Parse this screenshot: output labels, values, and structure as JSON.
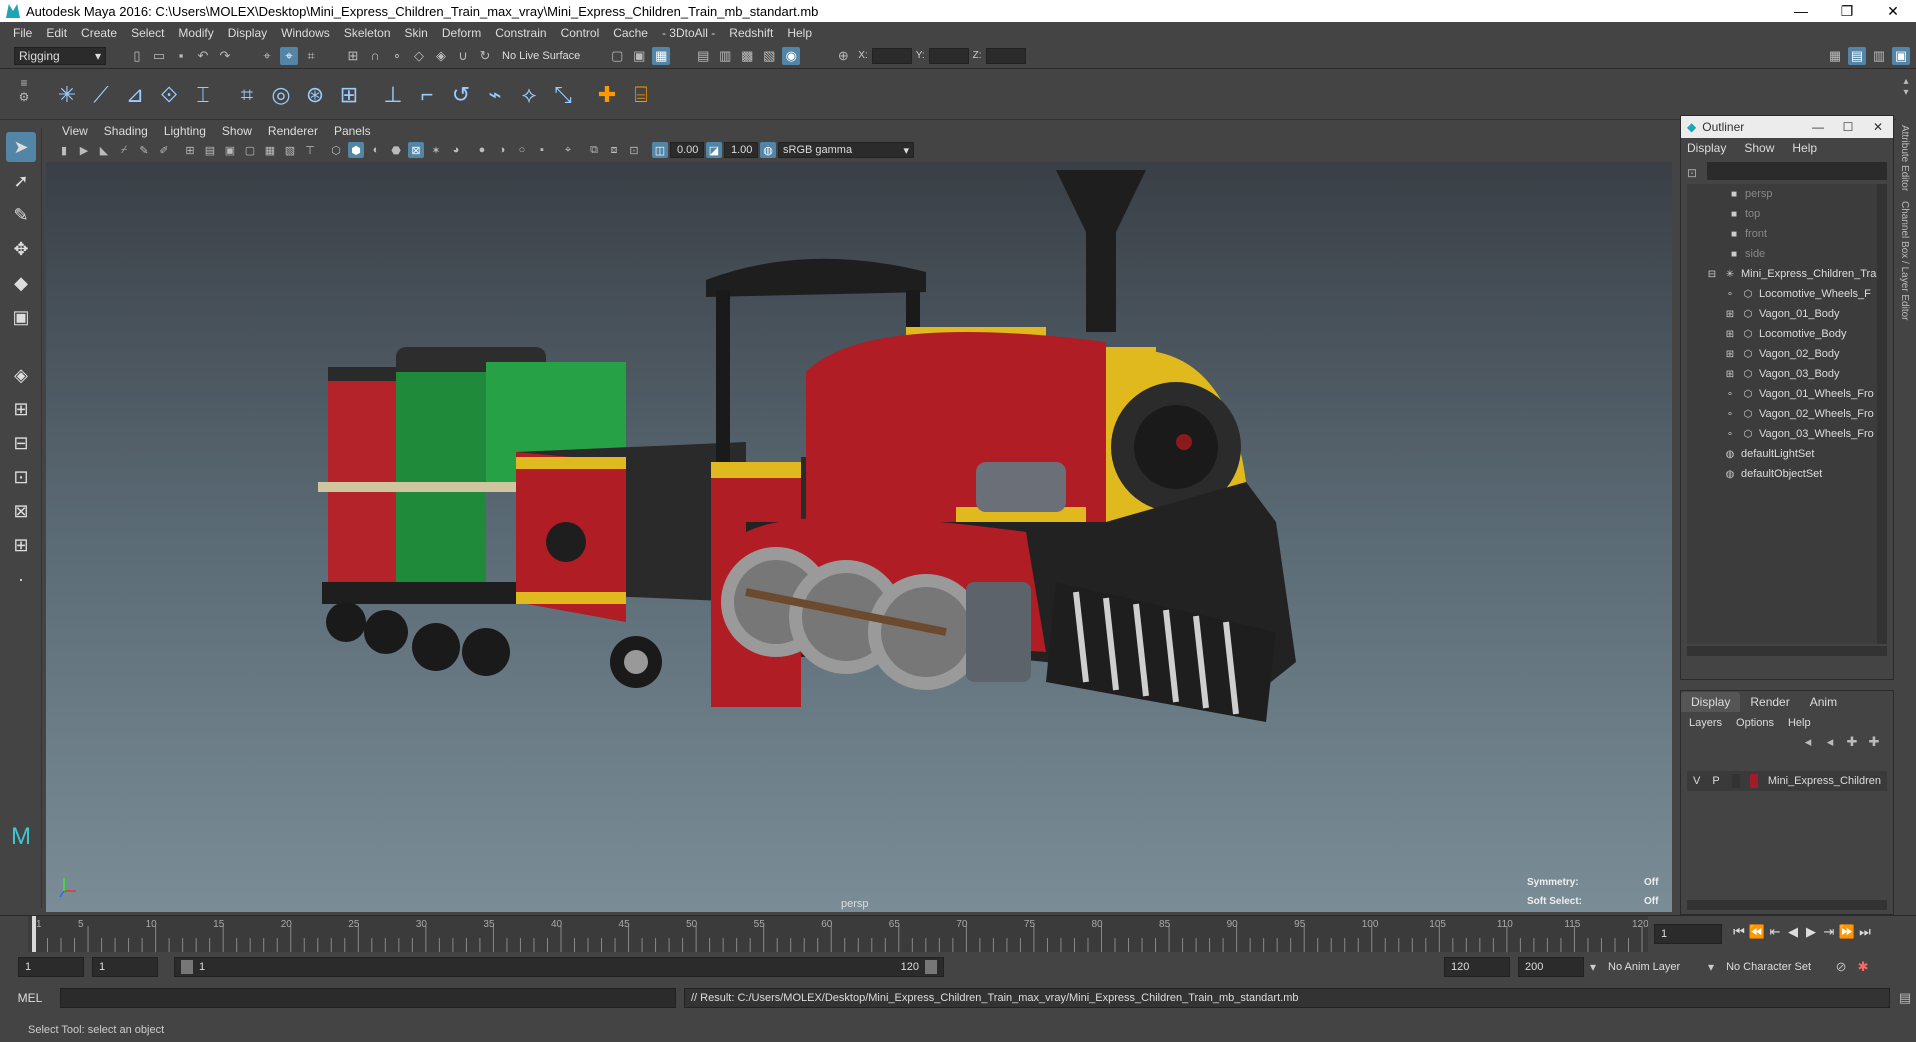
{
  "window": {
    "title": "Autodesk Maya 2016: C:\\Users\\MOLEX\\Desktop\\Mini_Express_Children_Train_max_vray\\Mini_Express_Children_Train_mb_standart.mb"
  },
  "menubar": [
    "File",
    "Edit",
    "Create",
    "Select",
    "Modify",
    "Display",
    "Windows",
    "Skeleton",
    "Skin",
    "Deform",
    "Constrain",
    "Control",
    "Cache",
    "- 3DtoAll -",
    "Redshift",
    "Help"
  ],
  "statusline": {
    "mode": "Rigging",
    "live_surface": "No Live Surface",
    "x_label": "X:",
    "y_label": "Y:",
    "z_label": "Z:"
  },
  "viewport": {
    "menu": [
      "View",
      "Shading",
      "Lighting",
      "Show",
      "Renderer",
      "Panels"
    ],
    "exposure": "0.00",
    "gamma": "1.00",
    "colorspace": "sRGB gamma",
    "camera_label": "persp",
    "symmetry_label": "Symmetry:",
    "symmetry_value": "Off",
    "soft_select_label": "Soft Select:",
    "soft_select_value": "Off"
  },
  "outliner": {
    "title": "Outliner",
    "menu": [
      "Display",
      "Show",
      "Help"
    ],
    "items": [
      {
        "label": "persp",
        "dim": true
      },
      {
        "label": "top",
        "dim": true
      },
      {
        "label": "front",
        "dim": true
      },
      {
        "label": "side",
        "dim": true
      },
      {
        "label": "Mini_Express_Children_Tra",
        "dim": false
      },
      {
        "label": "Locomotive_Wheels_F",
        "dim": false
      },
      {
        "label": "Vagon_01_Body",
        "dim": false
      },
      {
        "label": "Locomotive_Body",
        "dim": false
      },
      {
        "label": "Vagon_02_Body",
        "dim": false
      },
      {
        "label": "Vagon_03_Body",
        "dim": false
      },
      {
        "label": "Vagon_01_Wheels_Fro",
        "dim": false
      },
      {
        "label": "Vagon_02_Wheels_Fro",
        "dim": false
      },
      {
        "label": "Vagon_03_Wheels_Fro",
        "dim": false
      },
      {
        "label": "defaultLightSet",
        "dim": false
      },
      {
        "label": "defaultObjectSet",
        "dim": false
      }
    ]
  },
  "rightstrip": {
    "attr": "Attribute Editor",
    "channel": "Channel Box / Layer Editor"
  },
  "layers": {
    "tabs": [
      "Display",
      "Render",
      "Anim"
    ],
    "menu": [
      "Layers",
      "Options",
      "Help"
    ],
    "row": {
      "v": "V",
      "p": "P",
      "name": "Mini_Express_Children"
    }
  },
  "timeline": {
    "ticks": [
      "1",
      "5",
      "10",
      "15",
      "20",
      "25",
      "30",
      "35",
      "40",
      "45",
      "50",
      "55",
      "60",
      "65",
      "70",
      "75",
      "80",
      "85",
      "90",
      "95",
      "100",
      "105",
      "110",
      "115",
      "120"
    ],
    "current_frame": "1"
  },
  "range": {
    "start": "1",
    "start2": "1",
    "range_start": "1",
    "range_end": "120",
    "end": "120",
    "end2": "200",
    "anim_layer": "No Anim Layer",
    "char_set": "No Character Set"
  },
  "cmd": {
    "label": "MEL",
    "result": "// Result: C:/Users/MOLEX/Desktop/Mini_Express_Children_Train_max_vray/Mini_Express_Children_Train_mb_standart.mb"
  },
  "help": "Select Tool: select an object",
  "colors": {
    "accent": "#5285a6",
    "loco_red": "#b01d24",
    "yellow": "#e0b91e",
    "green": "#1f8a3a"
  }
}
